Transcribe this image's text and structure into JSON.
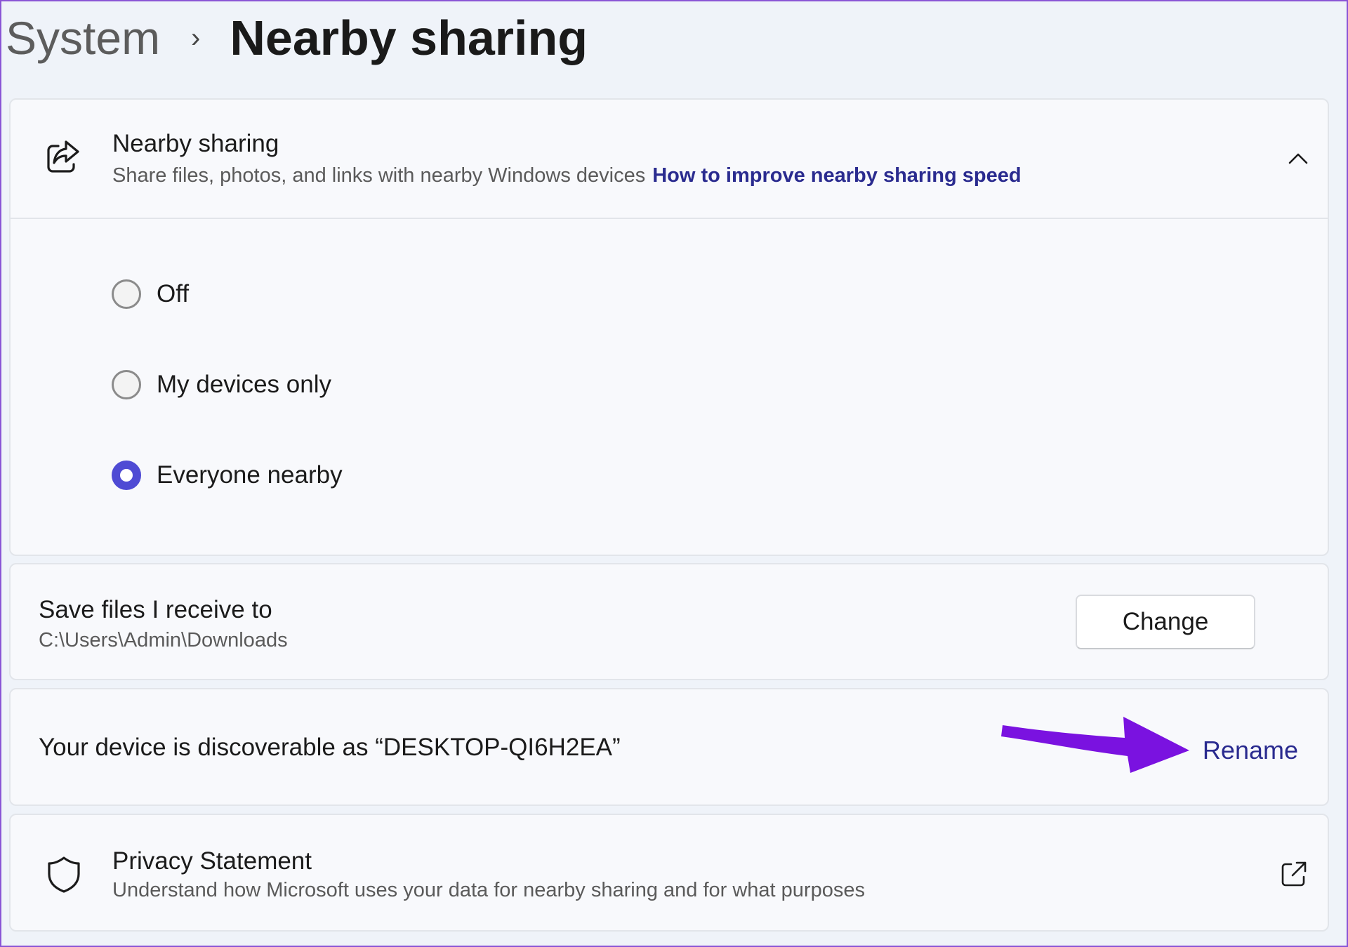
{
  "breadcrumb": {
    "parent": "System",
    "separator": "›",
    "current": "Nearby sharing"
  },
  "nearby_card": {
    "icon": "share-icon",
    "title": "Nearby sharing",
    "description": "Share files, photos, and links with nearby Windows devices",
    "link": "How to improve nearby sharing speed",
    "collapse_icon": "chevron-up-icon",
    "options": [
      {
        "label": "Off",
        "selected": false
      },
      {
        "label": "My devices only",
        "selected": false
      },
      {
        "label": "Everyone nearby",
        "selected": true
      }
    ]
  },
  "save_card": {
    "title": "Save files I receive to",
    "path": "C:\\Users\\Admin\\Downloads",
    "button_label": "Change"
  },
  "device_card": {
    "text": "Your device is discoverable as “DESKTOP-QI6H2EA”",
    "rename_label": "Rename"
  },
  "privacy_card": {
    "icon": "shield-icon",
    "title": "Privacy Statement",
    "description": "Understand how Microsoft uses your data for nearby sharing and for what purposes",
    "open_icon": "external-link-icon"
  },
  "colors": {
    "accent": "#4f4bd4",
    "link": "#2a2b8f",
    "annotation_arrow": "#7a12e0"
  }
}
